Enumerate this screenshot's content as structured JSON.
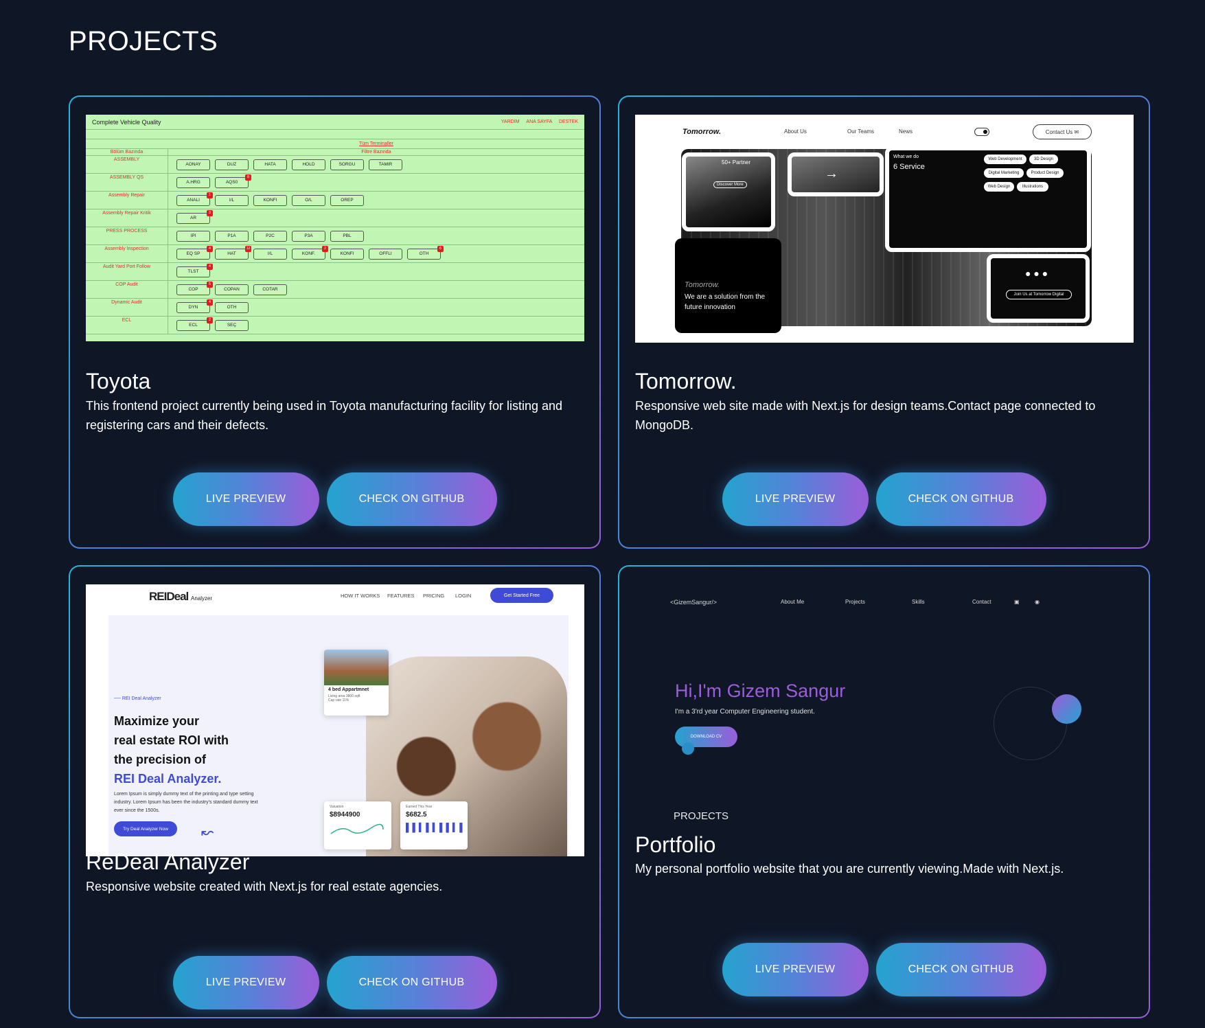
{
  "page": {
    "title": "PROJECTS"
  },
  "buttons": {
    "live": "LIVE PREVIEW",
    "github": "CHECK ON GITHUB"
  },
  "projects": [
    {
      "title": "Toyota",
      "description": "This frontend project currently being used in Toyota manufacturing facility for listing and registering cars and their defects."
    },
    {
      "title": "Tomorrow.",
      "description": "Responsive web site made with Next.js for design teams.Contact page connected to MongoDB."
    },
    {
      "title": "ReDeal Analyzer",
      "description": "Responsive website created with Next.js for real estate agencies."
    },
    {
      "title": "Portfolio",
      "description": "My personal portfolio website that you are currently viewing.Made with Next.js."
    }
  ],
  "toyota_shot": {
    "heading": "Complete Vehicle Quality",
    "nav": [
      "YARDIM",
      "ANA SAYFA",
      "DESTEK"
    ],
    "all_terminals": "Tüm Terminaller",
    "col1": "Bölüm Bazında",
    "col2": "Filtre Bazında",
    "rows": [
      {
        "label": "ASSEMBLY",
        "chips": [
          [
            "AONAY",
            ""
          ],
          [
            "DUZ",
            ""
          ],
          [
            "HATA",
            ""
          ],
          [
            "HOLD",
            ""
          ],
          [
            "SORGU",
            ""
          ],
          [
            "TAMIR",
            ""
          ]
        ]
      },
      {
        "label": "ASSEMBLY QS",
        "chips": [
          [
            "A.HRG",
            ""
          ],
          [
            "AQS0",
            "8"
          ]
        ]
      },
      {
        "label": "Assembly Repair",
        "chips": [
          [
            "ANALI",
            "1"
          ],
          [
            "I/L",
            ""
          ],
          [
            "KONFI",
            ""
          ],
          [
            "O/L",
            ""
          ],
          [
            "OREP",
            ""
          ]
        ]
      },
      {
        "label": "Assembly Repair Kritik",
        "chips": [
          [
            "AR",
            "3"
          ]
        ]
      },
      {
        "label": "PRESS PROCESS",
        "chips": [
          [
            "IPI",
            ""
          ],
          [
            "P1A",
            ""
          ],
          [
            "P2C",
            ""
          ],
          [
            "P3A",
            ""
          ],
          [
            "PBL",
            ""
          ]
        ]
      },
      {
        "label": "Assembly Inspection",
        "chips": [
          [
            "EQ SP",
            "4"
          ],
          [
            "HAT",
            "12"
          ],
          [
            "I/L",
            ""
          ],
          [
            "KONF.",
            "2"
          ],
          [
            "KONFI",
            ""
          ],
          [
            "OFFLI",
            ""
          ],
          [
            "OTH",
            "6"
          ]
        ]
      },
      {
        "label": "Audit Yard Port Follow",
        "chips": [
          [
            "TLST",
            "4"
          ]
        ]
      },
      {
        "label": "COP Audit",
        "chips": [
          [
            "COP",
            "5"
          ],
          [
            "COPAN",
            ""
          ],
          [
            "COTAR",
            ""
          ]
        ]
      },
      {
        "label": "Dynamic Audit",
        "chips": [
          [
            "DYN",
            "4"
          ],
          [
            "OTH",
            ""
          ]
        ]
      },
      {
        "label": "ECL",
        "chips": [
          [
            "ECL",
            "2"
          ],
          [
            "SEÇ",
            ""
          ]
        ]
      }
    ]
  },
  "tomorrow_shot": {
    "logo": "Tomorrow.",
    "nav": [
      "About Us",
      "Our Teams",
      "News"
    ],
    "contact": "Contact Us",
    "partner": "50+ Partner",
    "discover": "Discover More",
    "what_we_do": "What we do",
    "service": "6 Service",
    "services": [
      "Web Development",
      "3D Design",
      "Digital Marketing",
      "Product Design",
      "Web Design",
      "Illustrations"
    ],
    "tagline_brand": "Tomorrow.",
    "tagline": "We are a solution from the future innovation",
    "join": "Join Us at Tomorrow Digital"
  },
  "redeal_shot": {
    "logo": "REIDeal",
    "logo_sub": "Analyzer",
    "nav": [
      "HOW IT WORKS",
      "FEATURES",
      "PRICING",
      "LOGIN"
    ],
    "cta": "Get Started Free",
    "tag": "REI Deal Analyzer",
    "headline_1": "Maximize your",
    "headline_2": "real estate ROI with",
    "headline_3": "the precision of",
    "headline_4": "REI Deal Analyzer.",
    "paragraph": "Lorem Ipsum is simply dummy text of the printing and type setting industry. Lorem Ipsum has been the industry's standard dummy text ever since the 1500s.",
    "button": "Try Deal Analyzer Now",
    "listing": "4 bed Appartmnet",
    "listing_area": "Living area 3800 sqft",
    "listing_cap": "Cap rate 11%",
    "valuation_label": "Valuation",
    "valuation": "$8944900",
    "earned_label": "Earned This Year",
    "earned": "$682.5"
  },
  "portfolio_shot": {
    "logo": "<GizemSangur/>",
    "nav": [
      "About Me",
      "Projects",
      "Skills",
      "Contact"
    ],
    "hi": "Hi,I'm Gizem Sangur",
    "sub": "I'm a 3'rd year Computer Engineering student.",
    "download": "DOWNLOAD CV",
    "projects": "PROJECTS"
  },
  "colors": {
    "background": "#0f1626",
    "accent_start": "#24a3cf",
    "accent_end": "#9b5dd9"
  }
}
